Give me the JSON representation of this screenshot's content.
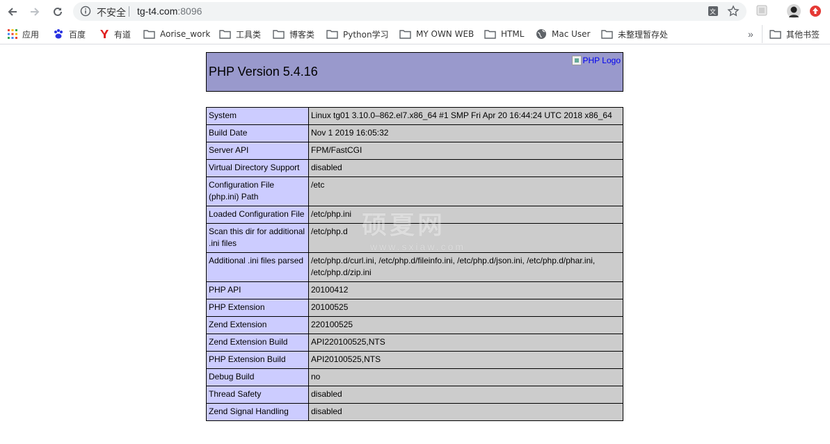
{
  "browser": {
    "security_label": "不安全",
    "url_host": "tg-t4.com",
    "url_port": ":8096"
  },
  "bookmarks": {
    "items": [
      {
        "label": "应用",
        "icon": "apps-grid-icon"
      },
      {
        "label": "百度",
        "icon": "baidu-paw-icon"
      },
      {
        "label": "有道",
        "icon": "youdao-icon"
      },
      {
        "label": "Aorise_work",
        "icon": "folder-icon"
      },
      {
        "label": "工具类",
        "icon": "folder-icon"
      },
      {
        "label": "博客类",
        "icon": "folder-icon"
      },
      {
        "label": "Python学习",
        "icon": "folder-icon"
      },
      {
        "label": "MY OWN WEB",
        "icon": "folder-icon"
      },
      {
        "label": "HTML",
        "icon": "folder-icon"
      },
      {
        "label": "Mac User",
        "icon": "globe-icon"
      },
      {
        "label": "未整理暂存处",
        "icon": "folder-icon"
      }
    ],
    "overflow_label": "»",
    "other_label": "其他书签"
  },
  "phpinfo": {
    "title": "PHP Version 5.4.16",
    "logo_alt": "PHP Logo",
    "rows": [
      {
        "key": "System",
        "value": "Linux tg01 3.10.0–862.el7.x86_64 #1 SMP Fri Apr 20 16:44:24 UTC 2018 x86_64"
      },
      {
        "key": "Build Date",
        "value": "Nov 1 2019 16:05:32"
      },
      {
        "key": "Server API",
        "value": "FPM/FastCGI"
      },
      {
        "key": "Virtual Directory Support",
        "value": "disabled"
      },
      {
        "key": "Configuration File (php.ini) Path",
        "value": "/etc"
      },
      {
        "key": "Loaded Configuration File",
        "value": "/etc/php.ini"
      },
      {
        "key": "Scan this dir for additional .ini files",
        "value": "/etc/php.d"
      },
      {
        "key": "Additional .ini files parsed",
        "value": "/etc/php.d/curl.ini, /etc/php.d/fileinfo.ini, /etc/php.d/json.ini, /etc/php.d/phar.ini, /etc/php.d/zip.ini"
      },
      {
        "key": "PHP API",
        "value": "20100412"
      },
      {
        "key": "PHP Extension",
        "value": "20100525"
      },
      {
        "key": "Zend Extension",
        "value": "220100525"
      },
      {
        "key": "Zend Extension Build",
        "value": "API220100525,NTS"
      },
      {
        "key": "PHP Extension Build",
        "value": "API20100525,NTS"
      },
      {
        "key": "Debug Build",
        "value": "no"
      },
      {
        "key": "Thread Safety",
        "value": "disabled"
      },
      {
        "key": "Zend Signal Handling",
        "value": "disabled"
      }
    ]
  },
  "watermark": {
    "main": "硕夏网",
    "sub": "www.sxiaw.com"
  },
  "colors": {
    "header_bg": "#9999cc",
    "key_bg": "#ccccff",
    "value_bg": "#cccccc"
  }
}
